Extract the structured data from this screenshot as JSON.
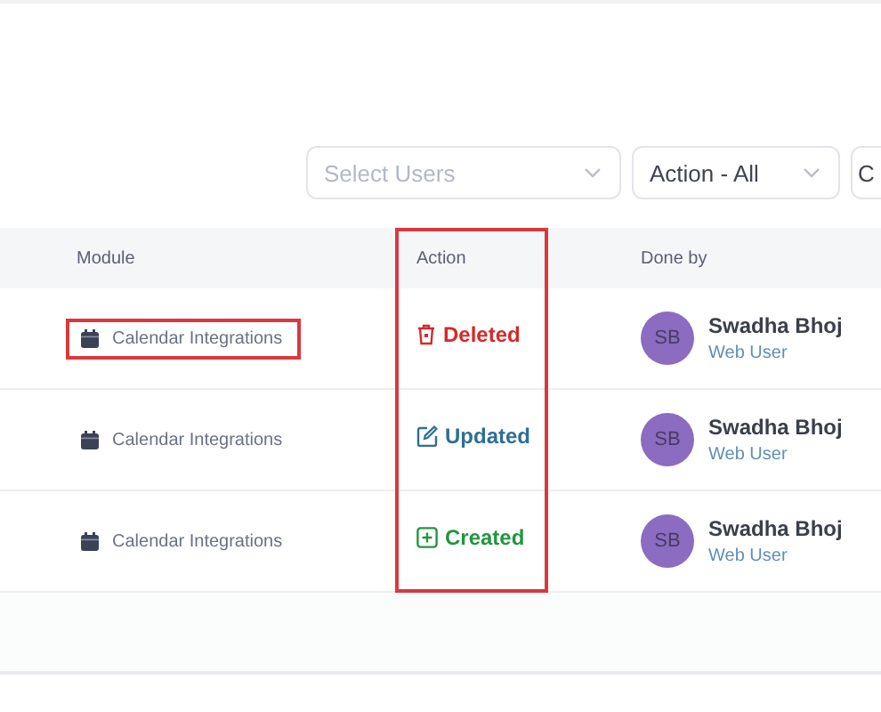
{
  "filters": [
    {
      "placeholder": "Select Users"
    },
    {
      "value": "Action - All"
    },
    {
      "value": "C"
    }
  ],
  "table": {
    "columns": [
      {
        "label": "Module",
        "highlighted": false
      },
      {
        "label": "Action",
        "highlighted": true
      },
      {
        "label": "Done by",
        "highlighted": false
      }
    ],
    "rows": [
      {
        "module": "Calendar Integrations",
        "module_highlighted": true,
        "action": {
          "kind": "deleted",
          "label": "Deleted"
        },
        "user": {
          "initials": "SB",
          "name": "Swadha Bhoj",
          "role": "Web User"
        }
      },
      {
        "module": "Calendar Integrations",
        "module_highlighted": false,
        "action": {
          "kind": "updated",
          "label": "Updated"
        },
        "user": {
          "initials": "SB",
          "name": "Swadha Bhoj",
          "role": "Web User"
        }
      },
      {
        "module": "Calendar Integrations",
        "module_highlighted": false,
        "action": {
          "kind": "created",
          "label": "Created"
        },
        "user": {
          "initials": "SB",
          "name": "Swadha Bhoj",
          "role": "Web User"
        }
      }
    ]
  }
}
